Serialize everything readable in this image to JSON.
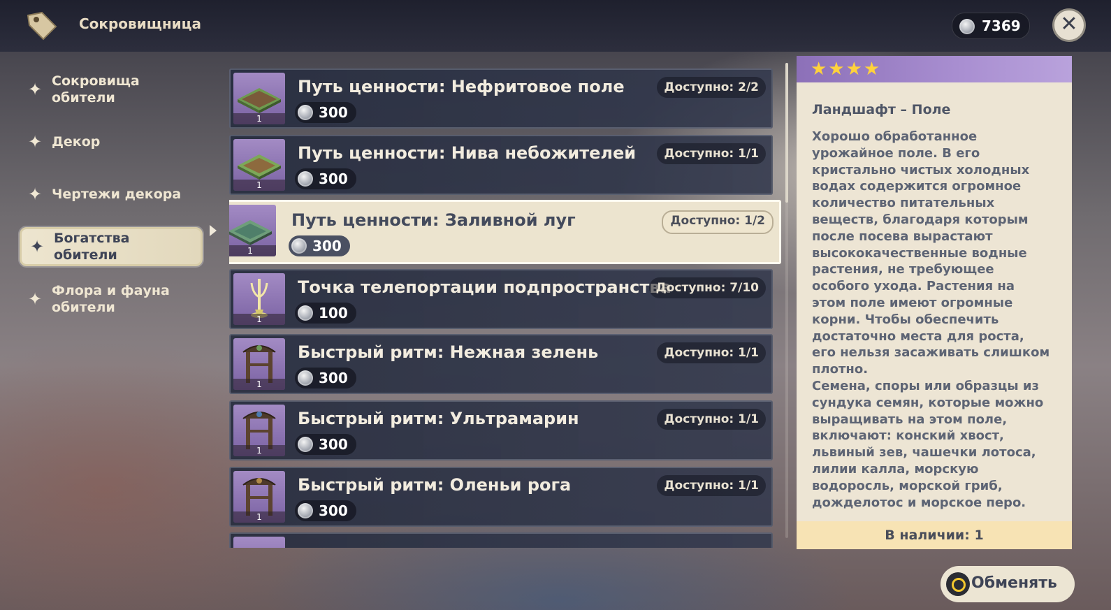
{
  "header": {
    "title": "Сокровищница",
    "currency_value": "7369",
    "close_icon": "close-icon",
    "tag_icon": "tag-icon"
  },
  "sidebar": {
    "items": [
      {
        "label": "Сокровища\nобители",
        "active": false
      },
      {
        "label": "Декор",
        "active": false
      },
      {
        "label": "Чертежи декора",
        "active": false
      },
      {
        "label": "Богатства\nобители",
        "active": true
      },
      {
        "label": "Флора и фауна\nобители",
        "active": false
      }
    ]
  },
  "items": [
    {
      "name": "Путь ценности: Нефритовое поле",
      "price": "300",
      "available": "Доступно: 2/2",
      "qty": "1",
      "thumb": "field-icon"
    },
    {
      "name": "Путь ценности: Нива небожителей",
      "price": "300",
      "available": "Доступно: 1/1",
      "qty": "1",
      "thumb": "field-icon"
    },
    {
      "name": "Путь ценности: Заливной луг",
      "price": "300",
      "available": "Доступно: 1/2",
      "qty": "1",
      "thumb": "field-icon",
      "selected": true
    },
    {
      "name": "Точка телепортации подпространства",
      "price": "100",
      "available": "Доступно: 7/10",
      "qty": "1",
      "thumb": "teleport-icon"
    },
    {
      "name": "Быстрый ритм: Нежная зелень",
      "price": "300",
      "available": "Доступно: 1/1",
      "qty": "1",
      "thumb": "gate-icon"
    },
    {
      "name": "Быстрый ритм: Ультрамарин",
      "price": "300",
      "available": "Доступно: 1/1",
      "qty": "1",
      "thumb": "gate-icon"
    },
    {
      "name": "Быстрый ритм: Оленьи рога",
      "price": "300",
      "available": "Доступно: 1/1",
      "qty": "1",
      "thumb": "gate-icon"
    }
  ],
  "detail": {
    "stars": "★★★★",
    "type": "Ландшафт – Поле",
    "description": "Хорошо обработанное\nурожайное поле. В его\nкристально чистых холодных\nводах содержится огромное\nколичество питательных\nвеществ, благодаря которым\nпосле посева вырастают\nвысококачественные водные\nрастения, не требующее\nособого ухода. Растения на\nэтом поле имеют огромные\nкорни. Чтобы обеспечить\nдостаточно места для роста,\nего нельзя засаживать слишком\nплотно.\nСемена, споры или образцы из\nсундука семян, которые можно\nвыращивать на этом поле,\nвключают: конский хвост,\nльвиный зев, чашечки лотоса,\nлилии калла, морскую\nводоросль, морской гриб,\nдожделотос и морское перо.",
    "stock": "В наличии: 1"
  },
  "exchange_button": {
    "label": "Обменять"
  }
}
